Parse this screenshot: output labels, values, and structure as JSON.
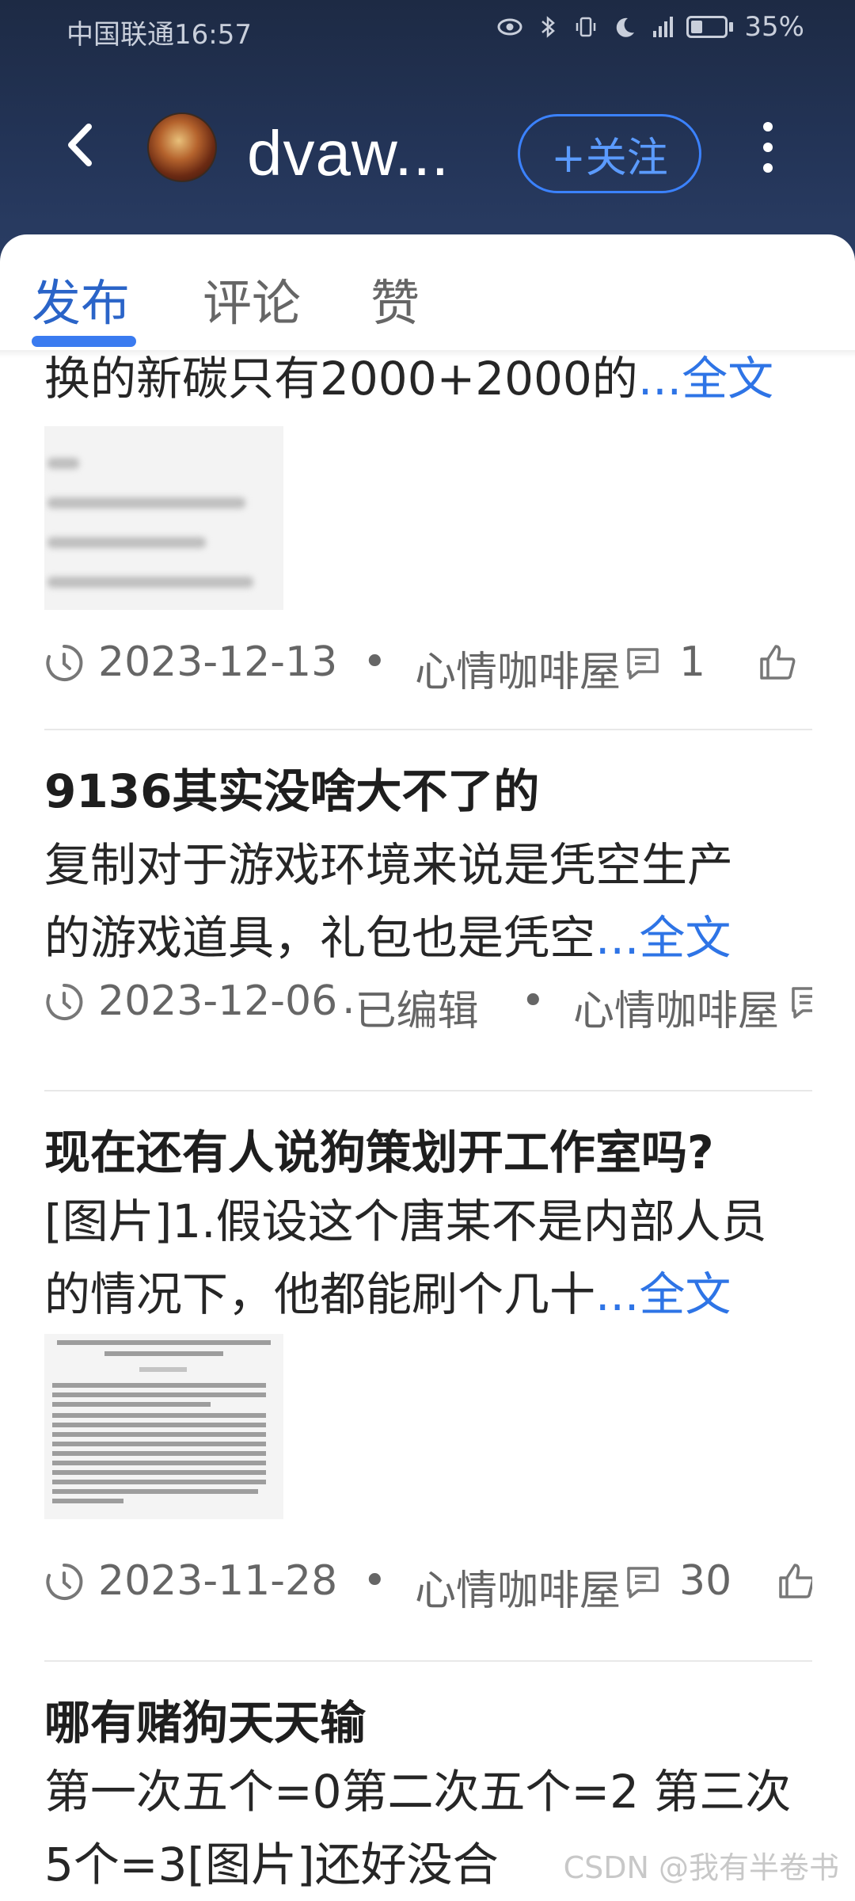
{
  "status_bar": {
    "carrier_time": "中国联通16:57",
    "battery": "35%",
    "battery_level": 0.35
  },
  "header": {
    "username": "dvaw...",
    "follow_label": "+关注"
  },
  "tabs": [
    {
      "label": "发布",
      "active": true
    },
    {
      "label": "评论",
      "active": false
    },
    {
      "label": "赞",
      "active": false
    }
  ],
  "posts": [
    {
      "body": "换的新碳只有2000+2000的",
      "more": "...全文",
      "date": "2023-12-13",
      "dot": "•",
      "community": "心情咖啡屋",
      "comments": "1"
    },
    {
      "title": "9136其实没啥大不了的",
      "body_line1": " 复制对于游戏环境来说是凭空生产",
      "body_line2": "的游戏道具，礼包也是凭空",
      "more": "...全文",
      "date": "2023-12-06",
      "edited": "·已编辑",
      "dot": "•",
      "community": "心情咖啡屋"
    },
    {
      "title": "现在还有人说狗策划开工作室吗?",
      "body_line1": "[图片]1.假设这个唐某不是内部人员",
      "body_line2": "的情况下，他都能刷个几十",
      "more": "...全文",
      "date": "2023-11-28",
      "dot": "•",
      "community": "心情咖啡屋",
      "comments": "30"
    },
    {
      "title": "哪有赌狗天天输",
      "body_line1": "第一次五个=0第二次五个=2 第三次",
      "body_line2": "5个=3[图片]还好没合"
    }
  ],
  "watermark": "CSDN @我有半卷书"
}
